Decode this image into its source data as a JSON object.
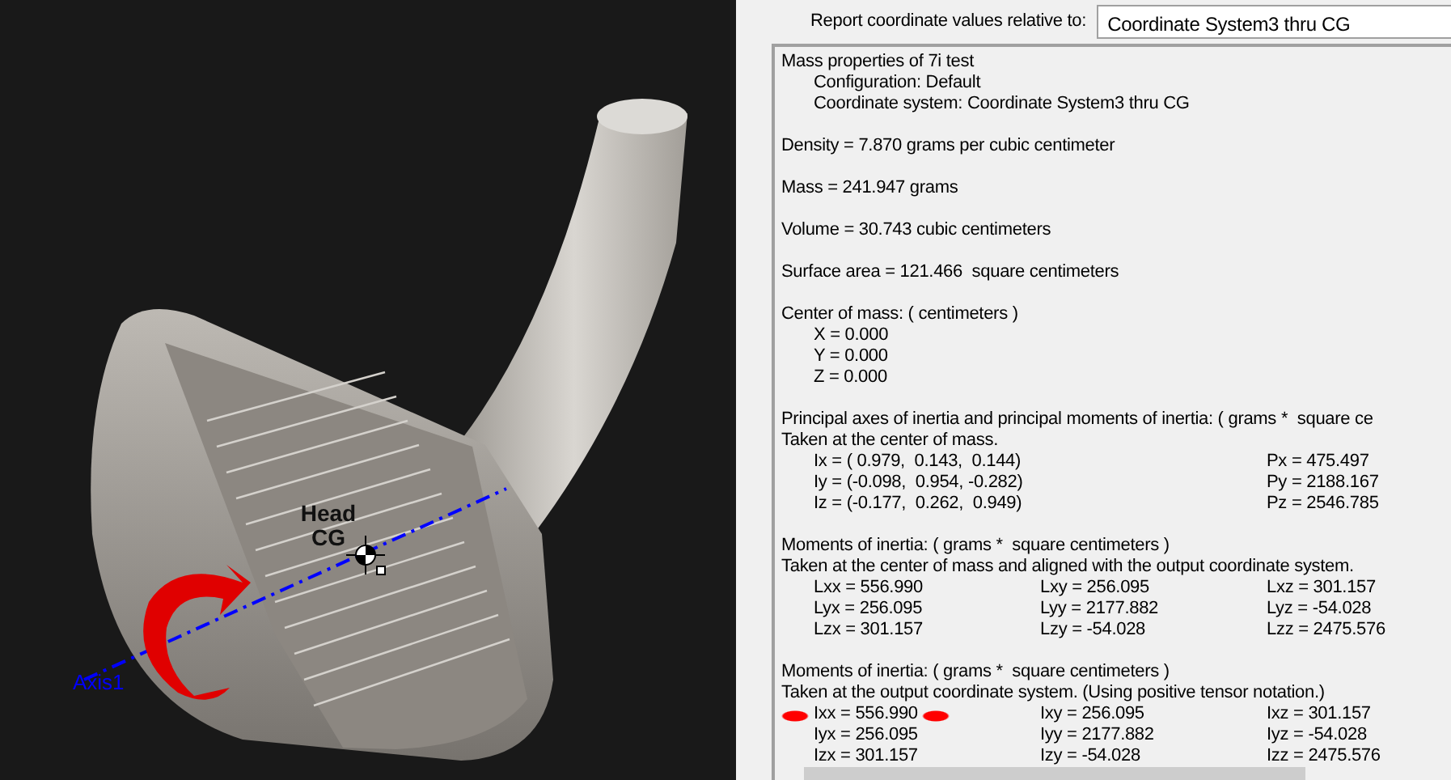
{
  "viewport": {
    "cg_label": [
      "Head",
      "CG"
    ],
    "axis_label": "Axis1"
  },
  "report": {
    "label": "Report coordinate values relative to:",
    "value": "Coordinate System3 thru CG"
  },
  "results": {
    "blocks": [
      {
        "kind": "outline",
        "heading": "Mass properties of 7i test",
        "children": [
          "Configuration: Default",
          "Coordinate system: Coordinate System3 thru CG"
        ]
      },
      {
        "kind": "outline",
        "heading": "Density = 7.870 grams per cubic centimeter"
      },
      {
        "kind": "outline",
        "heading": "Mass = 241.947 grams"
      },
      {
        "kind": "outline",
        "heading": "Volume = 30.743 cubic centimeters"
      },
      {
        "kind": "outline",
        "heading": "Surface area = 121.466  square centimeters"
      },
      {
        "kind": "outline",
        "heading": "Center of mass: ( centimeters )",
        "children": [
          "X = 0.000",
          "Y = 0.000",
          "Z = 0.000"
        ]
      },
      {
        "kind": "principal",
        "heading": "Principal axes of inertia and principal moments of inertia: ( grams *  square ce",
        "subheading": "Taken at the center of mass.",
        "rows": [
          {
            "axis": "Ix = ( 0.979,  0.143,  0.144)",
            "moment": "Px = 475.497"
          },
          {
            "axis": "Iy = (-0.098,  0.954, -0.282)",
            "moment": "Py = 2188.167"
          },
          {
            "axis": "Iz = (-0.177,  0.262,  0.949)",
            "moment": "Pz = 2546.785"
          }
        ]
      },
      {
        "kind": "matrix",
        "heading": "Moments of inertia: ( grams *  square centimeters )",
        "subheading": "Taken at the center of mass and aligned with the output coordinate system.",
        "rows": [
          [
            {
              "text": "Lxx = 556.990",
              "highlighted": false
            },
            {
              "text": "Lxy = 256.095",
              "highlighted": false
            },
            {
              "text": "Lxz = 301.157",
              "highlighted": false
            }
          ],
          [
            {
              "text": "Lyx = 256.095",
              "highlighted": false
            },
            {
              "text": "Lyy = 2177.882",
              "highlighted": false
            },
            {
              "text": "Lyz = -54.028",
              "highlighted": false
            }
          ],
          [
            {
              "text": "Lzx = 301.157",
              "highlighted": false
            },
            {
              "text": "Lzy = -54.028",
              "highlighted": false
            },
            {
              "text": "Lzz = 2475.576",
              "highlighted": false
            }
          ]
        ]
      },
      {
        "kind": "matrix",
        "heading": "Moments of inertia: ( grams *  square centimeters )",
        "subheading": "Taken at the output coordinate system. (Using positive tensor notation.)",
        "rows": [
          [
            {
              "text": "Ixx = 556.990",
              "highlighted": true
            },
            {
              "text": "Ixy = 256.095",
              "highlighted": false
            },
            {
              "text": "Ixz = 301.157",
              "highlighted": false
            }
          ],
          [
            {
              "text": "Iyx = 256.095",
              "highlighted": false
            },
            {
              "text": "Iyy = 2177.882",
              "highlighted": false
            },
            {
              "text": "Iyz = -54.028",
              "highlighted": false
            }
          ],
          [
            {
              "text": "Izx = 301.157",
              "highlighted": false
            },
            {
              "text": "Izy = -54.028",
              "highlighted": false
            },
            {
              "text": "Izz = 2475.576",
              "highlighted": false
            }
          ]
        ]
      }
    ]
  }
}
